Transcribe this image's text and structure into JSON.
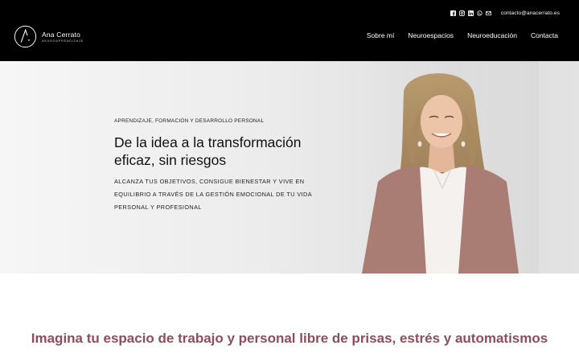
{
  "header": {
    "contact_email": "contacto@anacerrato.es",
    "social_icons": [
      "facebook-icon",
      "instagram-icon",
      "linkedin-icon",
      "whatsapp-icon",
      "email-icon"
    ],
    "logo": {
      "name": "Ana Cerrato",
      "subtitle": "NEUROAPRENDIZAJE"
    },
    "nav": [
      "Sobre mí",
      "Neuroespacios",
      "Neuroeducación",
      "Contacta"
    ]
  },
  "hero": {
    "overline": "APRENDIZAJE, FORMACIÓN Y DESARROLLO PERSONAL",
    "title": "De la idea a la transformación eficaz, sin riesgos",
    "description": "ALCANZA TUS OBJETIVOS, CONSIGUE BIENESTAR Y VIVE EN EQUILIBRIO A TRAVÉS DE LA GESTIÓN EMOCIONAL DE TU VIDA PERSONAL Y PROFESIONAL"
  },
  "section": {
    "title": "Imagina tu espacio de trabajo y personal libre de prisas, estrés y automatismos"
  },
  "colors": {
    "header_bg": "#000000",
    "accent": "#8a4f5c",
    "hero_bg": "#ececec"
  }
}
